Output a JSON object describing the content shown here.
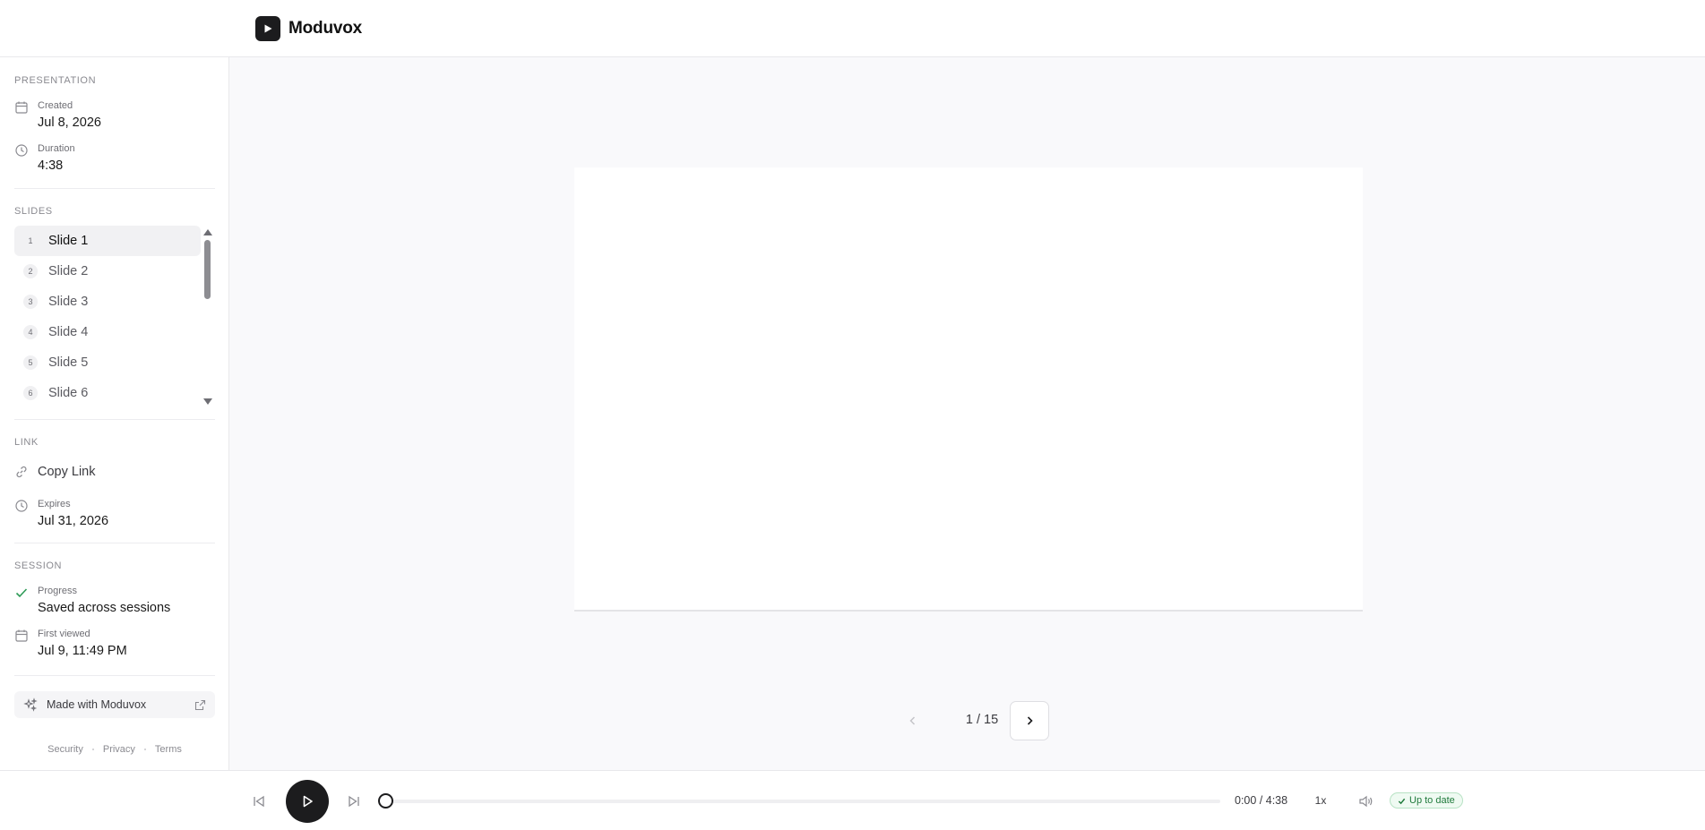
{
  "header": {
    "brand_name": "Moduvox",
    "logo_icon": "play-icon"
  },
  "sidebar": {
    "presentation": {
      "title": "PRESENTATION",
      "created_label": "Created",
      "created_value": "Jul 8, 2026",
      "duration_label": "Duration",
      "duration_value": "4:38"
    },
    "slides": {
      "title": "SLIDES",
      "items": [
        {
          "num": "1",
          "label": "Slide 1"
        },
        {
          "num": "2",
          "label": "Slide 2"
        },
        {
          "num": "3",
          "label": "Slide 3"
        },
        {
          "num": "4",
          "label": "Slide 4"
        },
        {
          "num": "5",
          "label": "Slide 5"
        },
        {
          "num": "6",
          "label": "Slide 6"
        }
      ]
    },
    "link": {
      "title": "LINK",
      "copy_label": "Copy Link",
      "expires_label": "Expires",
      "expires_value": "Jul 31, 2026"
    },
    "session": {
      "title": "SESSION",
      "progress_label": "Progress",
      "progress_value": "Saved across sessions",
      "first_viewed_label": "First viewed",
      "first_viewed_value": "Jul 9, 11:49 PM"
    },
    "made_with": "Made with Moduvox",
    "footer": {
      "security": "Security",
      "privacy": "Privacy",
      "terms": "Terms"
    }
  },
  "pager": {
    "text": "1 / 15"
  },
  "player": {
    "time": "0:00 / 4:38",
    "speed": "1x",
    "status": "Up to date",
    "progress": 0
  },
  "colors": {
    "accent": "#1c1c1e",
    "status_green": "#1f7a3b",
    "main_bg": "#f9f9fb"
  }
}
